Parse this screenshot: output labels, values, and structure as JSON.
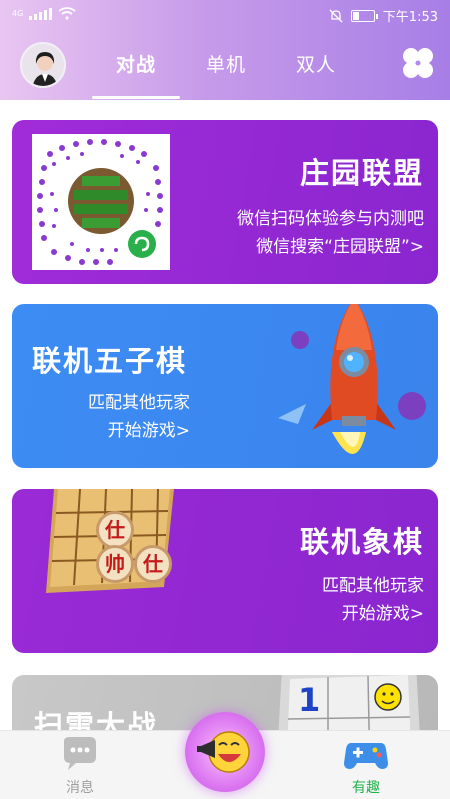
{
  "status_bar": {
    "network": "4G",
    "time": "下午1:53"
  },
  "header": {
    "tabs": [
      {
        "label": "对战",
        "active": true
      },
      {
        "label": "单机",
        "active": false
      },
      {
        "label": "双人",
        "active": false
      }
    ]
  },
  "cards": [
    {
      "title": "庄园联盟",
      "lines": [
        "微信扫码体验参与内测吧",
        "微信搜索“庄园联盟”>"
      ],
      "color": "#9a2ad6",
      "image": "qr-code"
    },
    {
      "title": "联机五子棋",
      "lines": [
        "匹配其他玩家",
        "开始游戏>"
      ],
      "color": "#3c8cf4",
      "image": "rocket"
    },
    {
      "title": "联机象棋",
      "lines": [
        "匹配其他玩家",
        "开始游戏>"
      ],
      "color": "#9a2ad6",
      "image": "chess-board"
    },
    {
      "title": "扫雷大战",
      "color": "#c0c0c0",
      "image": "minesweeper"
    }
  ],
  "chess_pieces": [
    "仕",
    "帅",
    "仕"
  ],
  "minesweeper_number": "1",
  "bottom_nav": {
    "items": [
      {
        "label": "消息",
        "icon": "chat-bubble-icon",
        "active": false,
        "color": "#9e9e9e"
      },
      {
        "label": "有趣",
        "icon": "gamepad-icon",
        "active": true,
        "color": "#22b14c"
      }
    ],
    "center_icon": "laughing-face-icon"
  }
}
